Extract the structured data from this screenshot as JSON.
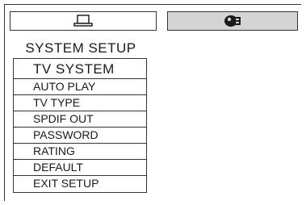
{
  "tabs": [
    {
      "icon": "monitor-icon",
      "active": true
    },
    {
      "icon": "settings-figure-icon",
      "active": false
    }
  ],
  "section_title": "SYSTEM SETUP",
  "menu": {
    "selected_index": 0,
    "items": [
      {
        "label": "TV SYSTEM"
      },
      {
        "label": "AUTO PLAY"
      },
      {
        "label": "TV TYPE"
      },
      {
        "label": "SPDIF OUT"
      },
      {
        "label": "PASSWORD"
      },
      {
        "label": "RATING"
      },
      {
        "label": "DEFAULT"
      },
      {
        "label": "EXIT SETUP"
      }
    ]
  },
  "colors": {
    "background": "#ffffff",
    "border": "#333333",
    "inactive_tab": "#d4d4d4",
    "text": "#1a1a1a"
  }
}
